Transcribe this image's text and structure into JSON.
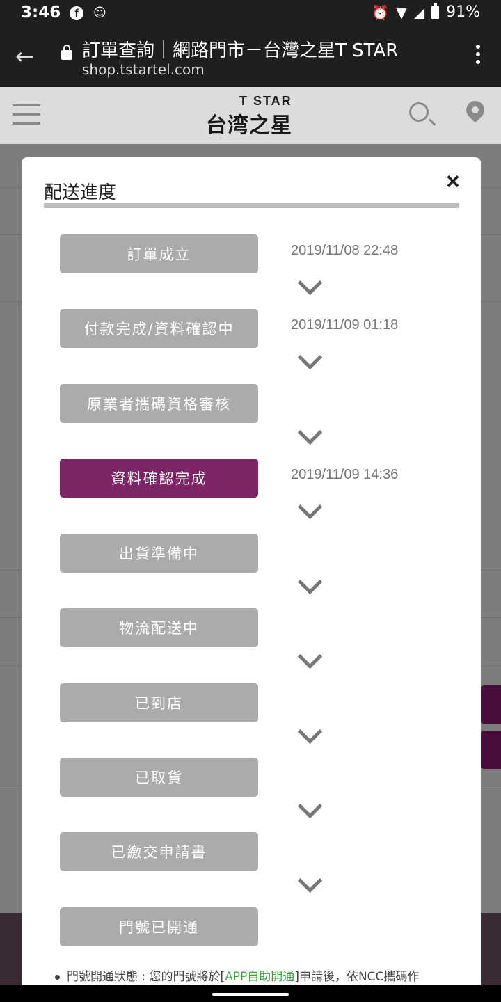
{
  "status_bar": {
    "time": "3:46",
    "battery": "91%",
    "icons": [
      "facebook-icon",
      "face-icon",
      "alarm-icon",
      "wifi-icon",
      "signal-icon",
      "battery-icon"
    ]
  },
  "browser": {
    "title": "訂單查詢｜網路門市－台灣之星T STAR",
    "url": "shop.tstartel.com"
  },
  "site_header": {
    "logo_top": "T STAR",
    "logo_main": "台湾之星"
  },
  "modal": {
    "title": "配送進度",
    "close": "×",
    "steps": [
      {
        "label": "訂單成立",
        "time": "2019/11/08 22:48",
        "active": false
      },
      {
        "label": "付款完成/資料確認中",
        "time": "2019/11/09 01:18",
        "active": false
      },
      {
        "label": "原業者攜碼資格審核",
        "time": "",
        "active": false
      },
      {
        "label": "資料確認完成",
        "time": "2019/11/09 14:36",
        "active": true
      },
      {
        "label": "出貨準備中",
        "time": "",
        "active": false
      },
      {
        "label": "物流配送中",
        "time": "",
        "active": false
      },
      {
        "label": "已到店",
        "time": "",
        "active": false
      },
      {
        "label": "已取貨",
        "time": "",
        "active": false
      },
      {
        "label": "已繳交申請書",
        "time": "",
        "active": false
      },
      {
        "label": "門號已開通",
        "time": "",
        "active": false
      }
    ],
    "note": {
      "prefix": "門號開通狀態 : 您的門號將於[",
      "link": "APP自助開通",
      "suffix": "]申請後，依NCC攜碼作"
    }
  },
  "colors": {
    "active_step": "#7d2466",
    "inactive_step": "#ababab",
    "link": "#3aa53a"
  }
}
